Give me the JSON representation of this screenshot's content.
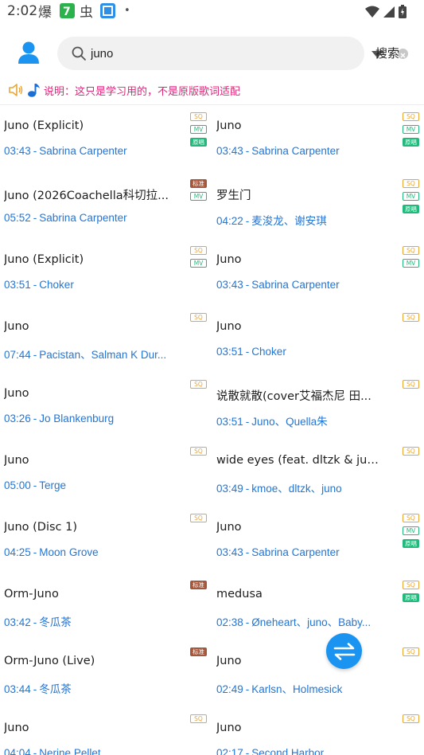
{
  "status_bar": {
    "time": "2:02",
    "notif_icons": [
      "weibo-icon",
      "seven-app-icon",
      "bug-icon",
      "blue-app-icon"
    ],
    "dot": "•"
  },
  "search": {
    "query": "juno",
    "button_label": "搜索"
  },
  "notice": {
    "text": "说明：这只是学习用的，不是原版歌词适配"
  },
  "badge_labels": {
    "sq": "SQ",
    "mv": "MV",
    "yc": "原唱",
    "bz": "标准"
  },
  "songs": [
    [
      {
        "title": "Juno (Explicit)",
        "duration": "03:43",
        "artist": "Sabrina Carpenter",
        "badges": [
          "sq",
          "mv",
          "yc"
        ]
      },
      {
        "title": "Juno",
        "duration": "03:43",
        "artist": "Sabrina Carpenter",
        "badges": [
          "sq",
          "mv",
          "yc"
        ]
      }
    ],
    [
      {
        "title": " Juno (2026Coachella科切拉...",
        "duration": "05:52",
        "artist": "Sabrina Carpenter",
        "badges": [
          "bz",
          "mv"
        ]
      },
      {
        "title": "罗生门",
        "duration": "04:22",
        "artist": "麦浚龙、谢安琪",
        "badges": [
          "sq",
          "mv",
          "yc"
        ]
      }
    ],
    [
      {
        "title": "Juno (Explicit)",
        "duration": "03:51",
        "artist": "Choker",
        "badges": [
          "sq",
          "mv"
        ]
      },
      {
        "title": "Juno",
        "duration": "03:43",
        "artist": "Sabrina Carpenter",
        "badges": [
          "sq",
          "mv"
        ]
      }
    ],
    [
      {
        "title": "Juno",
        "duration": "07:44",
        "artist": "Pacistan、Salman K Dur...",
        "badges": [
          "sq"
        ]
      },
      {
        "title": "Juno",
        "duration": "03:51",
        "artist": "Choker",
        "badges": [
          "sq"
        ]
      }
    ],
    [
      {
        "title": "Juno",
        "duration": "03:26",
        "artist": "Jo Blankenburg",
        "badges": [
          "sq"
        ]
      },
      {
        "title": " 说散就散(cover艾福杰尼 田...",
        "duration": "03:51",
        "artist": "Juno、Quella朱",
        "badges": [
          "sq"
        ]
      }
    ],
    [
      {
        "title": "Juno",
        "duration": "05:00",
        "artist": "Terge",
        "badges": [
          "sq"
        ]
      },
      {
        "title": "wide eyes (feat. dltzk & juno)",
        "duration": "03:49",
        "artist": "kmoe、dltzk、juno",
        "badges": [
          "sq"
        ]
      }
    ],
    [
      {
        "title": "Juno (Disc 1)",
        "duration": "04:25",
        "artist": "Moon Grove",
        "badges": [
          "sq"
        ]
      },
      {
        "title": "Juno",
        "duration": "03:43",
        "artist": "Sabrina Carpenter",
        "badges": [
          "sq",
          "mv",
          "yc"
        ]
      }
    ],
    [
      {
        "title": "Orm-Juno",
        "duration": "03:42",
        "artist": "冬瓜茶",
        "badges": [
          "bz"
        ]
      },
      {
        "title": "medusa",
        "duration": "02:38",
        "artist": "Øneheart、juno、Baby...",
        "badges": [
          "sq",
          "yc"
        ]
      }
    ],
    [
      {
        "title": "Orm-Juno (Live)",
        "duration": "03:44",
        "artist": "冬瓜茶",
        "badges": [
          "bz"
        ]
      },
      {
        "title": "Juno",
        "duration": "02:49",
        "artist": "Karlsn、Holmesick",
        "badges": [
          "sq"
        ]
      }
    ],
    [
      {
        "title": "Juno",
        "duration": "04:04",
        "artist": "Nerine Pellet",
        "badges": [
          "sq"
        ]
      },
      {
        "title": "Juno",
        "duration": "02:17",
        "artist": "Second Harbor",
        "badges": [
          "sq"
        ]
      }
    ]
  ],
  "colors": {
    "accent_blue": "#2176d9",
    "notice_pink": "#e0247a",
    "fab_blue": "#1a94f0",
    "sq_orange": "#e8a735",
    "mv_green": "#25b87c",
    "bz_brown": "#a4573a"
  }
}
